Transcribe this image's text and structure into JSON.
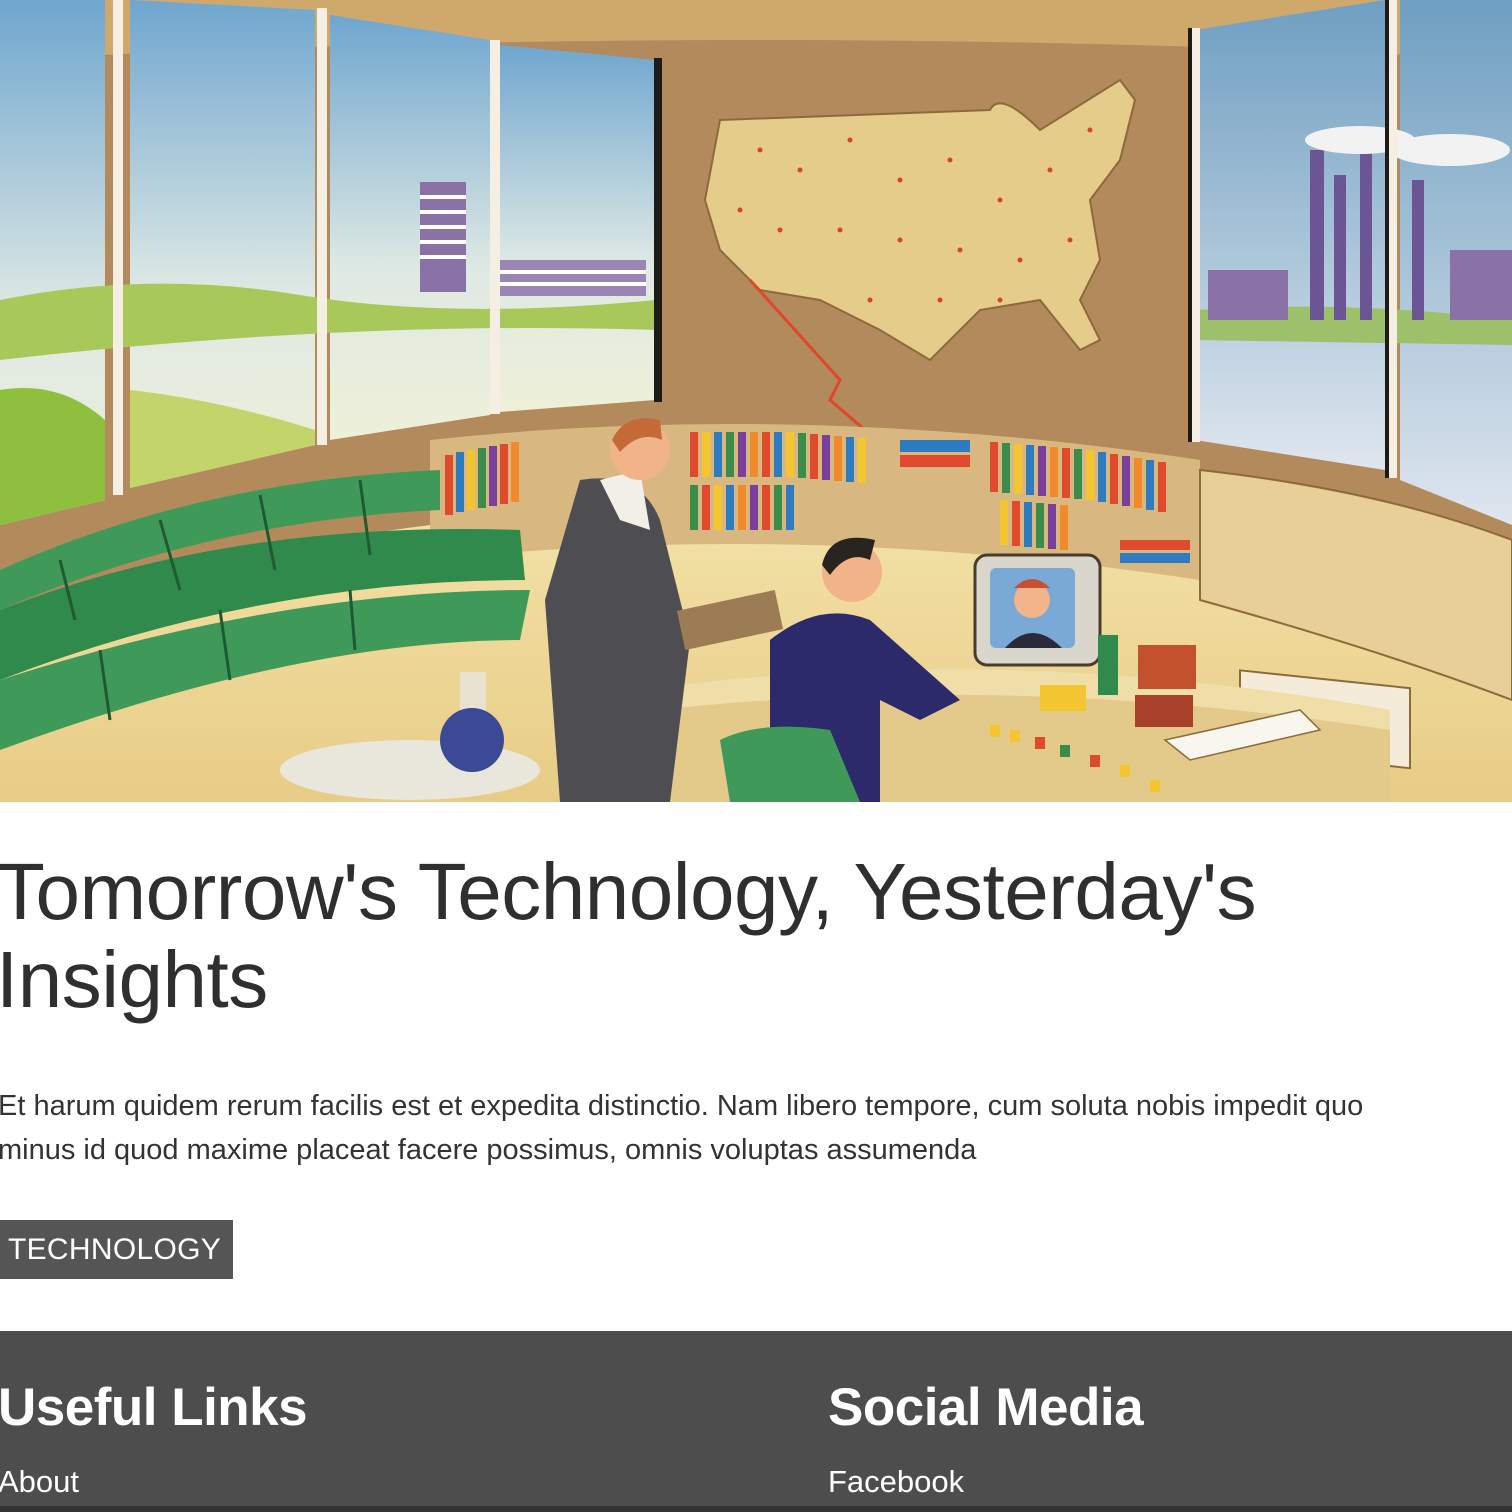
{
  "hero": {
    "image_name": "retro-office-illustration"
  },
  "article": {
    "title": "Tomorrow's Technology, Yesterday's Insights",
    "excerpt_lines": [
      "Et harum quidem rerum facilis est et expedita distinctio. Nam libero tempore, cum soluta nobis impedit quo",
      "minus id quod maxime placeat facere possimus, omnis voluptas assumenda"
    ],
    "tag": "TECHNOLOGY"
  },
  "footer": {
    "useful_links": {
      "heading": "Useful Links",
      "links": [
        "About"
      ]
    },
    "social_media": {
      "heading": "Social Media",
      "links": [
        "Facebook"
      ]
    }
  },
  "colors": {
    "tag_bg": "#555555",
    "footer_bg": "#4d4d4d",
    "text": "#2f2f2f"
  }
}
